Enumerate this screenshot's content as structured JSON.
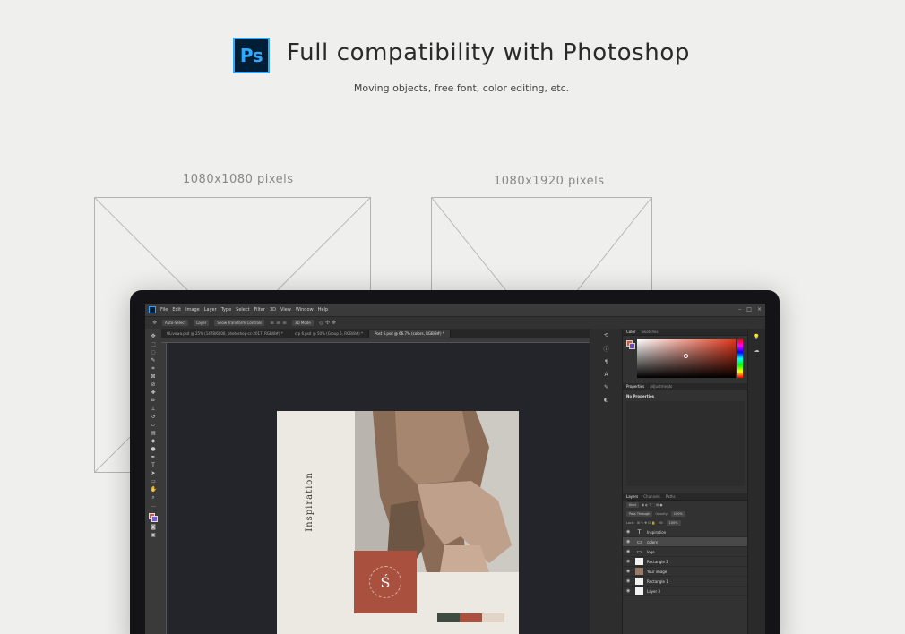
{
  "hero": {
    "logo_text": "Ps",
    "title": "Full compatibility with Photoshop",
    "subtitle": "Moving objects, free font, color editing, etc."
  },
  "frames": [
    {
      "label": "1080x1080 pixels"
    },
    {
      "label": "1080x1920 pixels"
    }
  ],
  "photoshop": {
    "menu": [
      "File",
      "Edit",
      "Image",
      "Layer",
      "Type",
      "Select",
      "Filter",
      "3D",
      "View",
      "Window",
      "Help"
    ],
    "options": {
      "auto_select": "Auto-Select",
      "layer_select": "Layer",
      "transform": "Show Transform Controls",
      "mode_3d": "3D Mode"
    },
    "tabs": [
      {
        "label": "OLivowa.psd @ 25% (1478/6000, photoshop-cc-2017, RGB/8#) *"
      },
      {
        "label": "crp 6.psd @ 50% (Group 5, RGB/8#) *"
      },
      {
        "label": "Post 6.psd @ 66.7% (colors, RGB/8#) *"
      }
    ],
    "active_tab": 2,
    "color_panel": {
      "tabs": [
        "Color",
        "Swatches"
      ],
      "fg": "#d35a3a",
      "bg": "#6d49c4"
    },
    "properties_panel": {
      "tabs": [
        "Properties",
        "Adjustments"
      ],
      "empty_text": "No Properties"
    },
    "layers_panel": {
      "tabs": [
        "Layers",
        "Channels",
        "Paths"
      ],
      "kind": "Kind",
      "blend": "Pass Through",
      "opacity_label": "Opacity:",
      "opacity": "100%",
      "lock_label": "Lock:",
      "fill_label": "Fill:",
      "fill": "100%",
      "layers": [
        {
          "name": "Inspiration",
          "icon": "text-layer-icon"
        },
        {
          "name": "colors",
          "icon": "folder-icon"
        },
        {
          "name": "logo",
          "icon": "folder-icon"
        },
        {
          "name": "Rectangle 2",
          "icon": "raster-icon"
        },
        {
          "name": "Your image",
          "icon": "smart-object-icon"
        },
        {
          "name": "Rectangle 1",
          "icon": "raster-icon"
        },
        {
          "name": "Layer 3",
          "icon": "raster-icon"
        }
      ],
      "selected": 1
    }
  },
  "post": {
    "vertical_text": "Inspiration",
    "logo_letter": "Ś",
    "palette": [
      "#3f4a40",
      "#a9513e",
      "#e2d4c6"
    ]
  }
}
